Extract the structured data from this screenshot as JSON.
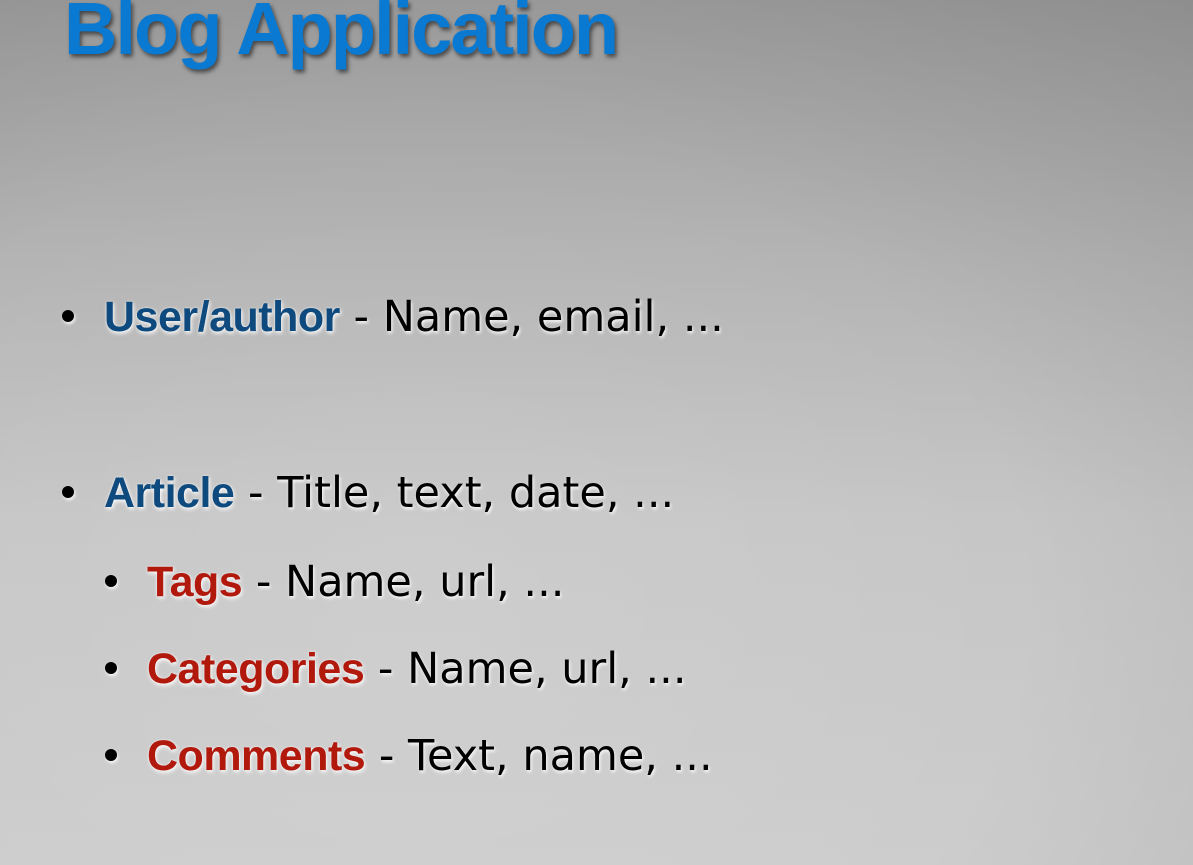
{
  "slide": {
    "title": "Blog Application",
    "items": [
      {
        "term": "User/author",
        "desc": " - Name, email, ..."
      },
      {
        "term": "Article",
        "desc": " - Title, text, date, ...",
        "children": [
          {
            "term": "Tags",
            "desc": " - Name, url, ..."
          },
          {
            "term": "Categories",
            "desc": " - Name, url, ..."
          },
          {
            "term": "Comments",
            "desc": " - Text, name, ..."
          }
        ]
      }
    ]
  },
  "colors": {
    "title": "#0a79d1",
    "term_primary": "#0e4a7e",
    "term_secondary": "#b2190d",
    "text": "#000000"
  }
}
